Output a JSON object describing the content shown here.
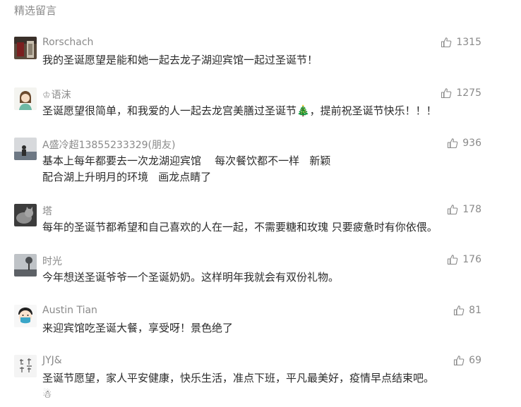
{
  "section": {
    "title": "精选留言"
  },
  "comments": [
    {
      "author": "Rorschach",
      "badge": "",
      "avatar": "avatar-rorschach",
      "likes": "1315",
      "lines": [
        "我的圣诞愿望是能和她一起去龙子湖迎宾馆一起过圣诞节！"
      ],
      "extra": ""
    },
    {
      "author": "语沫",
      "badge": "crown",
      "avatar": "avatar-cartoon-girl",
      "likes": "1275",
      "lines": [
        "圣诞愿望很简单，和我爱的人一起去龙宫美膳过圣诞节🎄，提前祝圣诞节快乐！！！"
      ],
      "extra": ""
    },
    {
      "author": "A盛冷超13855233329(朋友)",
      "badge": "",
      "avatar": "avatar-lakeside",
      "likes": "936",
      "lines": [
        "基本上每年都要去一次龙湖迎宾馆    每次餐饮都不一样   新颖",
        "配合湖上升明月的环境   画龙点睛了"
      ],
      "extra": ""
    },
    {
      "author": "塔",
      "badge": "",
      "avatar": "avatar-cat",
      "likes": "178",
      "lines": [
        "每年的圣诞节都希望和自己喜欢的人在一起，不需要糖和玫瑰 只要疲惫时有你依偎。"
      ],
      "extra": ""
    },
    {
      "author": "时光",
      "badge": "",
      "avatar": "avatar-tree-landscape",
      "likes": "176",
      "lines": [
        "今年想送圣诞爷爷一个圣诞奶奶。这样明年我就会有双份礼物。"
      ],
      "extra": ""
    },
    {
      "author": "Austin Tian",
      "badge": "",
      "avatar": "avatar-masked-cartoon",
      "likes": "81",
      "lines": [
        "来迎宾馆吃圣诞大餐，享受呀！景色绝了"
      ],
      "extra": ""
    },
    {
      "author": "JYJ&",
      "badge": "",
      "avatar": "avatar-calligraphy",
      "likes": "69",
      "lines": [
        "圣诞节愿望，家人平安健康，快乐生活，准点下班，平凡最美好，疫情早点结束吧。"
      ],
      "extra": "☃"
    }
  ],
  "icons": {
    "like": "thumbs-up-icon",
    "badge": "crown-icon"
  },
  "colors": {
    "meta": "#8a8a8a",
    "text": "#2b2b2b",
    "background": "#ffffff"
  }
}
